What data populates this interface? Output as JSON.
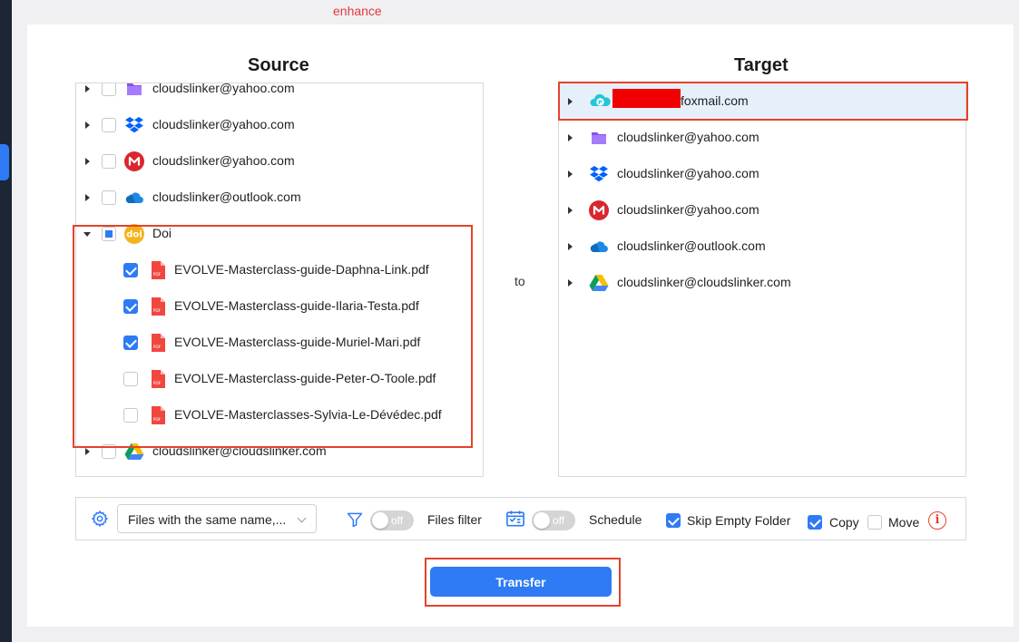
{
  "top_label": "enhance",
  "source": {
    "heading": "Source",
    "accounts": [
      {
        "label": "cloudslinker@yahoo.com",
        "icon": "purple-folder-icon"
      },
      {
        "label": "cloudslinker@yahoo.com",
        "icon": "dropbox-icon"
      },
      {
        "label": "cloudslinker@yahoo.com",
        "icon": "mega-icon"
      },
      {
        "label": "cloudslinker@outlook.com",
        "icon": "onedrive-icon"
      }
    ],
    "doi": {
      "label": "Doi",
      "icon": "doi-icon",
      "files": [
        {
          "name": "EVOLVE-Masterclass-guide-Daphna-Link.pdf",
          "checked": true
        },
        {
          "name": "EVOLVE-Masterclass-guide-Ilaria-Testa.pdf",
          "checked": true
        },
        {
          "name": "EVOLVE-Masterclass-guide-Muriel-Mari.pdf",
          "checked": true
        },
        {
          "name": "EVOLVE-Masterclass-guide-Peter-O-Toole.pdf",
          "checked": false
        },
        {
          "name": "EVOLVE-Masterclasses-Sylvia-Le-Dévédec.pdf",
          "checked": false
        }
      ]
    },
    "last_account": {
      "label": "cloudslinker@cloudslinker.com",
      "icon": "google-drive-icon"
    }
  },
  "to_label": "to",
  "target": {
    "heading": "Target",
    "accounts": [
      {
        "label": "foxmail.com",
        "icon": "pcloud-icon"
      },
      {
        "label": "cloudslinker@yahoo.com",
        "icon": "purple-folder-icon"
      },
      {
        "label": "cloudslinker@yahoo.com",
        "icon": "dropbox-icon"
      },
      {
        "label": "cloudslinker@yahoo.com",
        "icon": "mega-icon"
      },
      {
        "label": "cloudslinker@outlook.com",
        "icon": "onedrive-icon"
      },
      {
        "label": "cloudslinker@cloudslinker.com",
        "icon": "google-drive-icon"
      }
    ]
  },
  "toolbar": {
    "conflict_select": "Files with the same name,...",
    "files_filter_toggle": "off",
    "files_filter_label": "Files filter",
    "schedule_toggle": "off",
    "schedule_label": "Schedule",
    "skip_empty_label": "Skip Empty Folder",
    "copy_label": "Copy",
    "move_label": "Move",
    "info_glyph": "i"
  },
  "transfer_label": "Transfer",
  "colors": {
    "accent": "#2f7bf5",
    "highlight": "#e3432b"
  }
}
